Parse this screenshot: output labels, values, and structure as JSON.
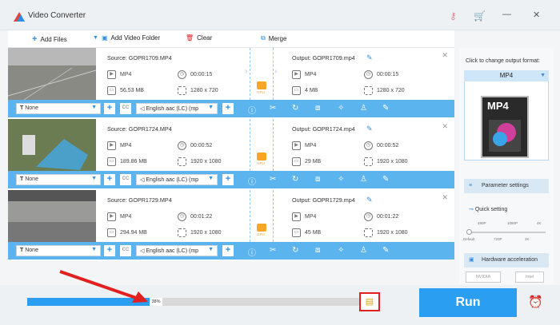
{
  "app": {
    "title": "Video Converter"
  },
  "toolbar": {
    "add_files": "Add Files",
    "add_folder": "Add Video Folder",
    "clear": "Clear",
    "merge": "Merge"
  },
  "items": [
    {
      "source": "Source: GOPR1709.MP4",
      "output": "Output: GOPR1709.mp4",
      "src_format": "MP4",
      "src_duration": "00:00:15",
      "src_size": "56.53 MB",
      "src_res": "1280 x 720",
      "out_format": "MP4",
      "out_duration": "00:00:15",
      "out_size": "4 MB",
      "out_res": "1280 x 720",
      "subtitle": "None",
      "audio": "English aac (LC) (mp"
    },
    {
      "source": "Source: GOPR1724.MP4",
      "output": "Output: GOPR1724.mp4",
      "src_format": "MP4",
      "src_duration": "00:00:52",
      "src_size": "189.86 MB",
      "src_res": "1920 x 1080",
      "out_format": "MP4",
      "out_duration": "00:00:52",
      "out_size": "29 MB",
      "out_res": "1920 x 1080",
      "subtitle": "None",
      "audio": "English aac (LC) (mp"
    },
    {
      "source": "Source: GOPR1729.MP4",
      "output": "Output: GOPR1729.mp4",
      "src_format": "MP4",
      "src_duration": "00:01:22",
      "src_size": "294.94 MB",
      "src_res": "1920 x 1080",
      "out_format": "MP4",
      "out_duration": "00:01:22",
      "out_size": "45 MB",
      "out_res": "1920 x 1080",
      "subtitle": "None",
      "audio": "English aac (LC) (mp"
    }
  ],
  "gpu_label": "GPU",
  "right": {
    "title": "Click to change output format:",
    "format": "MP4",
    "format_img": "MP4",
    "param": "Parameter settings",
    "quick": "Quick setting",
    "ticks_top": [
      "480P",
      "1080P",
      "4K"
    ],
    "ticks_bottom": [
      "Default",
      "720P",
      "2K"
    ],
    "hw": "Hardware acceleration",
    "nvidia": "NVIDIA",
    "intel": "Intel"
  },
  "progress": {
    "value": 0.38,
    "label": "38%"
  },
  "run": "Run",
  "colors": {
    "accent": "#2a9ef0",
    "highlight": "#e32020"
  }
}
